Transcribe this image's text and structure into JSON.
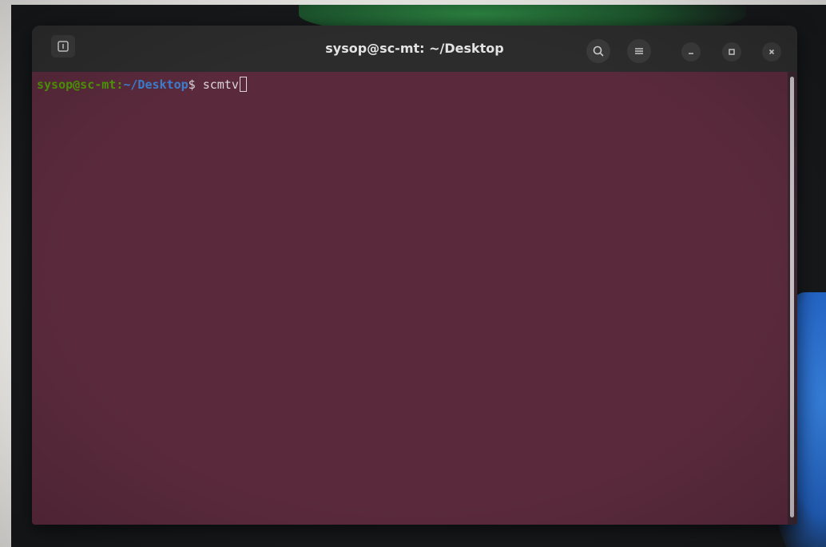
{
  "window": {
    "title": "sysop@sc-mt: ~/Desktop"
  },
  "titlebar": {
    "new_tab_icon": "new-tab-icon",
    "search_icon": "search-icon",
    "menu_icon": "hamburger-menu-icon",
    "minimize_icon": "minimize-icon",
    "maximize_icon": "maximize-icon",
    "close_icon": "close-icon"
  },
  "terminal": {
    "prompt_user_host": "sysop@sc-mt",
    "prompt_separator": ":",
    "prompt_path": "~/Desktop",
    "prompt_symbol": "$ ",
    "command": "scmtv"
  },
  "colors": {
    "terminal_background": "#5a2a3c",
    "prompt_user_color": "#4e9a06",
    "prompt_path_color": "#3d7fd0",
    "text_color": "#dcd6d8",
    "titlebar_background": "#2c2c2c"
  }
}
